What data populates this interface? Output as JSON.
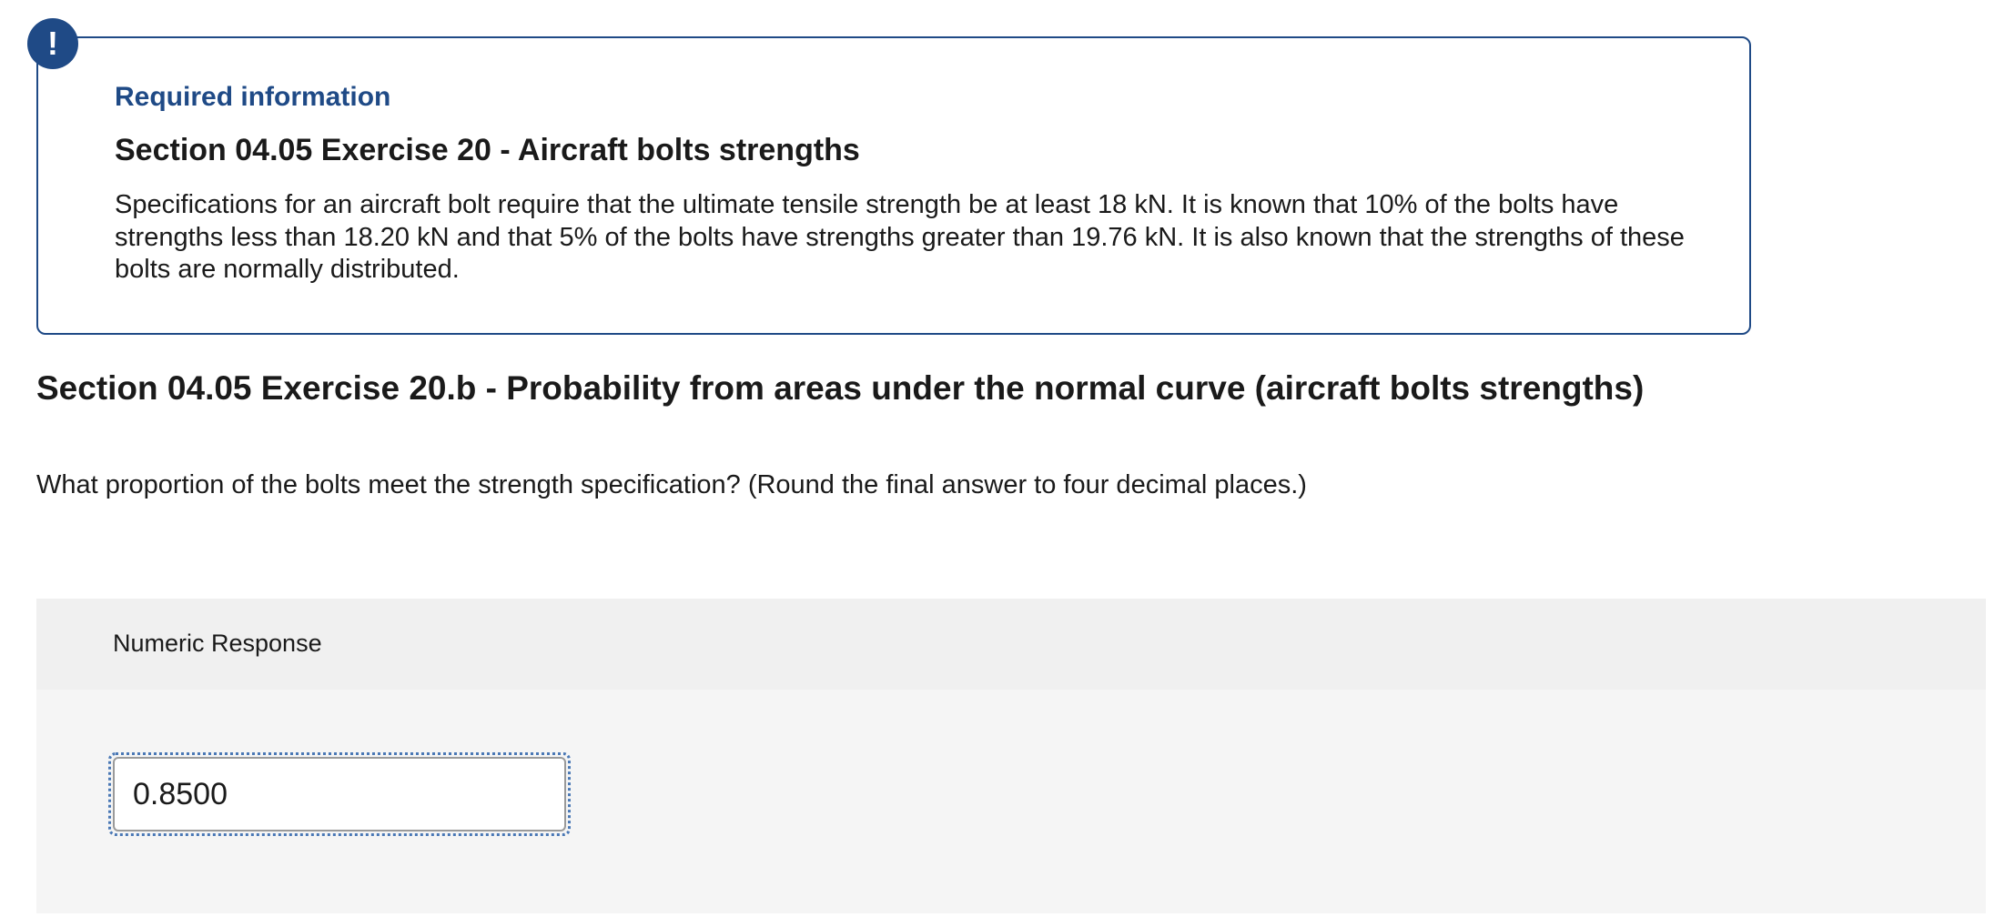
{
  "info_card": {
    "badge_glyph": "!",
    "required_label": "Required information",
    "title": "Section 04.05 Exercise 20 - Aircraft bolts strengths",
    "body": "Specifications for an aircraft bolt require that the ultimate tensile strength be at least 18 kN. It is known that 10% of the bolts have strengths less than 18.20 kN and that 5% of the bolts have strengths greater than 19.76 kN. It is also known that the strengths of these bolts are normally distributed."
  },
  "section": {
    "heading": "Section 04.05 Exercise 20.b - Probability from areas under the normal curve (aircraft bolts strengths)",
    "question": "What proportion of the bolts meet the strength specification? (Round the final answer to four decimal places.)"
  },
  "response": {
    "label": "Numeric Response",
    "value": "0.8500"
  },
  "colors": {
    "accent": "#1f4a86",
    "panel_background": "#f5f5f5",
    "focus_ring": "#4a78b5"
  }
}
